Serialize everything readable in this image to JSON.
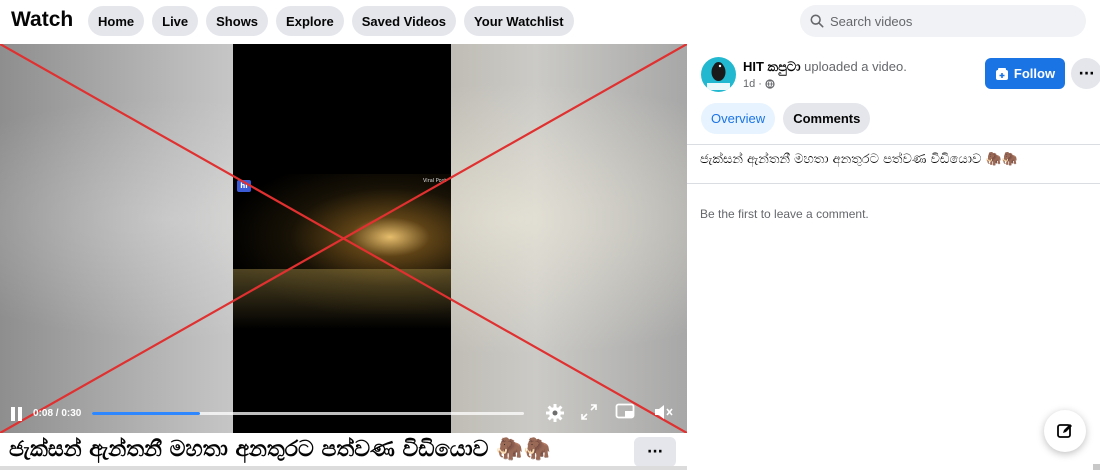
{
  "header": {
    "title": "Watch",
    "nav": [
      "Home",
      "Live",
      "Shows",
      "Explore",
      "Saved Videos",
      "Your Watchlist"
    ],
    "search_placeholder": "Search videos",
    "search_icon": "search-icon"
  },
  "video": {
    "time": "0:08 / 0:30",
    "progress": 0.25,
    "watermark_left": "hi",
    "watermark_right": "Viral Post",
    "title": "ජැක්සන් ඇන්තනී මහතා අනතුරට පත්වණ විඩියොව 🦣🦣",
    "icons": [
      "pause-icon",
      "settings-icon",
      "fullscreen-icon",
      "miniplayer-icon",
      "mute-icon"
    ],
    "x_color": "#e03030"
  },
  "post": {
    "page_name": "HIT කපුටා",
    "action_text": "uploaded a video.",
    "age": "1d ·",
    "follow_label": "Follow",
    "more_label": "···",
    "tabs": [
      "Overview",
      "Comments"
    ],
    "description": "ජැක්සන් ඇන්තනී මහතා අනතුරට පත්වණ විඩියොව 🦣🦣",
    "empty_comments": "Be the first to leave a comment."
  },
  "colors": {
    "accent": "#1b74e4",
    "pill": "#e4e6eb",
    "tab_active_bg": "#e7f3ff"
  }
}
